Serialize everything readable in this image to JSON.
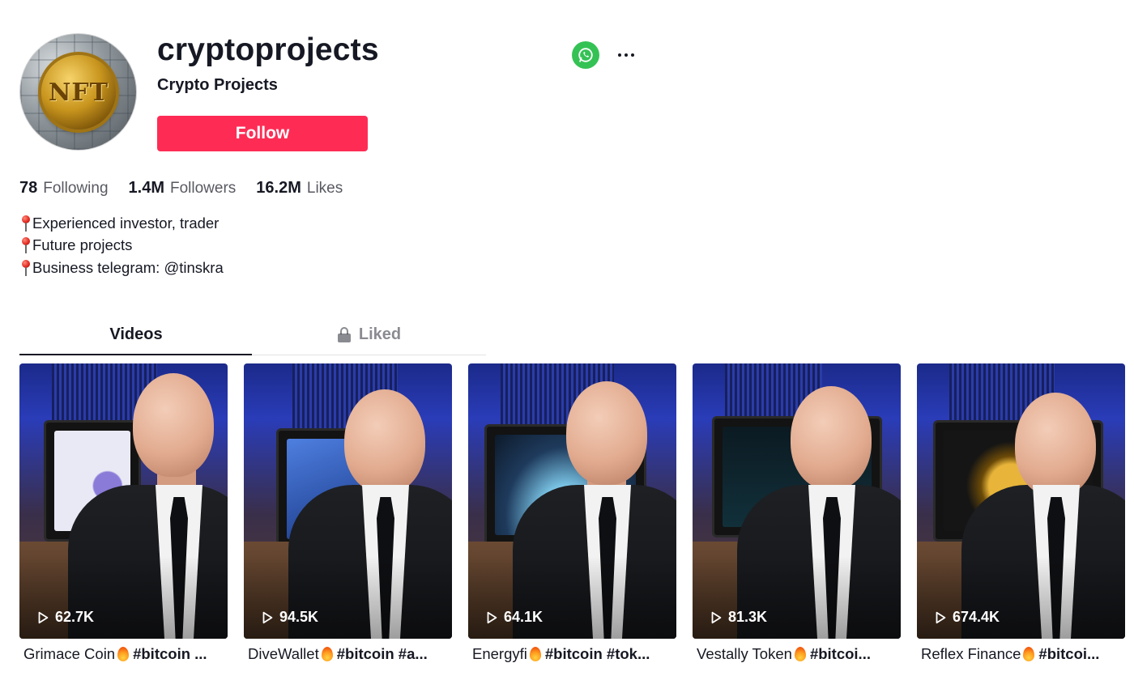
{
  "profile": {
    "username": "cryptoprojects",
    "nickname": "Crypto Projects",
    "avatar_text": "NFT",
    "follow_label": "Follow",
    "share_icon": "whatsapp-icon",
    "more_icon": "more-icon"
  },
  "stats": {
    "following": {
      "value": "78",
      "label": "Following"
    },
    "followers": {
      "value": "1.4M",
      "label": "Followers"
    },
    "likes": {
      "value": "16.2M",
      "label": "Likes"
    }
  },
  "bio": [
    "Experienced investor, trader",
    "Future projects",
    "Business telegram: @tinskra"
  ],
  "tabs": {
    "videos": "Videos",
    "liked": "Liked"
  },
  "videos": [
    {
      "views": "62.7K",
      "title": "Grimace Coin",
      "tags": "#bitcoin ...",
      "accent": "#8a7bd8"
    },
    {
      "views": "94.5K",
      "title": "DiveWallet",
      "tags": "#bitcoin #a...",
      "accent": "#3f6fd0"
    },
    {
      "views": "64.1K",
      "title": "Energyfi",
      "tags": "#bitcoin #tok...",
      "accent": "#2c86a8"
    },
    {
      "views": "81.3K",
      "title": "Vestally Token",
      "tags": "#bitcoi...",
      "accent": "#2e8c6b"
    },
    {
      "views": "674.4K",
      "title": "Reflex Finance",
      "tags": "#bitcoi...",
      "accent": "#c9961e"
    }
  ],
  "colors": {
    "follow": "#fe2c55",
    "whatsapp": "#35c255",
    "text": "#161823"
  }
}
